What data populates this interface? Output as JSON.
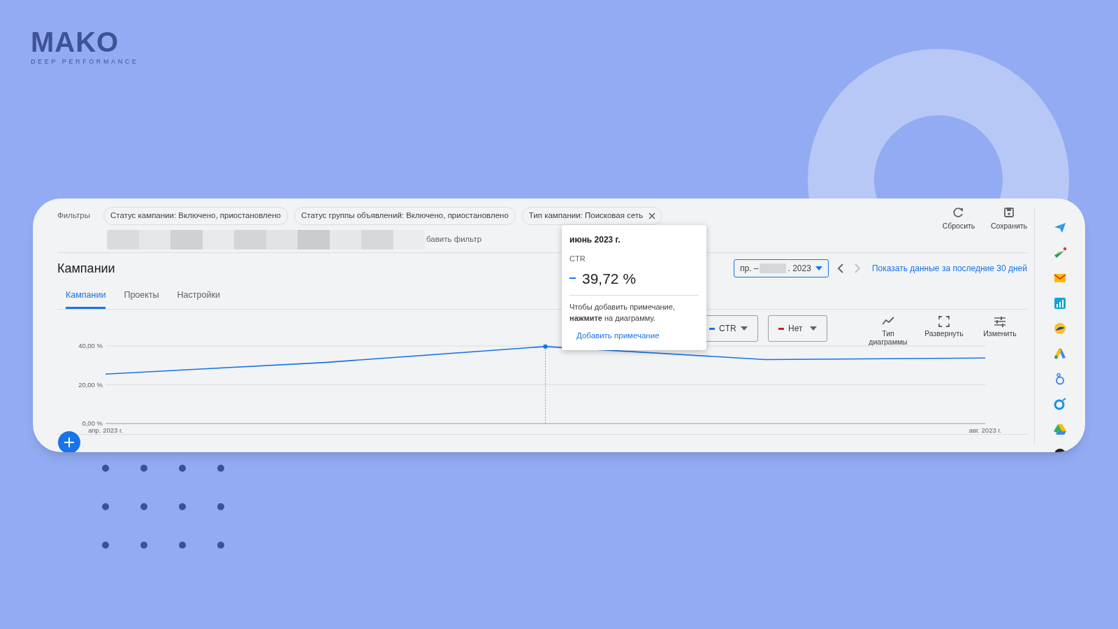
{
  "logo": {
    "name": "MAKO",
    "tagline": "DEEP PERFORMANCE"
  },
  "filters": {
    "label": "Фильтры",
    "chips": [
      {
        "text": "Статус кампании: Включено, приостановлено",
        "closable": false
      },
      {
        "text": "Статус группы объявлений: Включено, приостановлено",
        "closable": false
      },
      {
        "text": "Тип кампании: Поисковая сеть",
        "closable": true
      }
    ],
    "add_filter": "бавить фильтр"
  },
  "toolbar": [
    {
      "label": "Сбросить",
      "kind": "reset"
    },
    {
      "label": "Сохранить",
      "kind": "save"
    }
  ],
  "heading": "Кампании",
  "date_range": {
    "start": "пр. –",
    "end": ". 2023"
  },
  "date_nav": [
    {
      "kind": "prev",
      "disabled": false
    },
    {
      "kind": "next",
      "disabled": true
    }
  ],
  "show_last_30": "Показать данные за последние 30 дней",
  "tabs": [
    {
      "label": "Кампании",
      "selected": true
    },
    {
      "label": "Проекты",
      "selected": false
    },
    {
      "label": "Настройки",
      "selected": false
    }
  ],
  "metrics": [
    {
      "label": "CTR",
      "color": "#1a73e8"
    },
    {
      "label": "Нет",
      "color": "#c5221f"
    }
  ],
  "chart_tools": [
    {
      "label": "Тип диаграммы",
      "kind": "chart-type"
    },
    {
      "label": "Развернуть",
      "kind": "expand"
    },
    {
      "label": "Изменить",
      "kind": "adjust"
    }
  ],
  "chart_data": {
    "type": "line",
    "categories": [
      "апр. 2023 г.",
      null,
      null,
      null,
      "авг. 2023 г."
    ],
    "ylim": [
      0,
      40
    ],
    "yticks": [
      {
        "value": 0,
        "label": "0,00 %"
      },
      {
        "value": 20,
        "label": "20,00 %"
      },
      {
        "value": 40,
        "label": "40,00 %"
      }
    ],
    "series": [
      {
        "color": "#1a73e8",
        "values": [
          25.5,
          31.5,
          39.7,
          33,
          33.8
        ]
      }
    ]
  },
  "tooltip": {
    "title": "июнь 2023 г.",
    "metric": "CTR",
    "value": "39,72 %",
    "hint": "Чтобы добавить примечание, **нажмите** на диаграмму.",
    "link": "Добавить примечание"
  },
  "sidebar_apps": [
    {
      "kind": "plane"
    },
    {
      "kind": "plane-alert"
    },
    {
      "kind": "mail"
    },
    {
      "kind": "bars"
    },
    {
      "kind": "swirl"
    },
    {
      "kind": "ads"
    },
    {
      "kind": "ring-figure"
    },
    {
      "kind": "ring"
    },
    {
      "kind": "drive"
    },
    {
      "kind": "dark-circle"
    }
  ]
}
